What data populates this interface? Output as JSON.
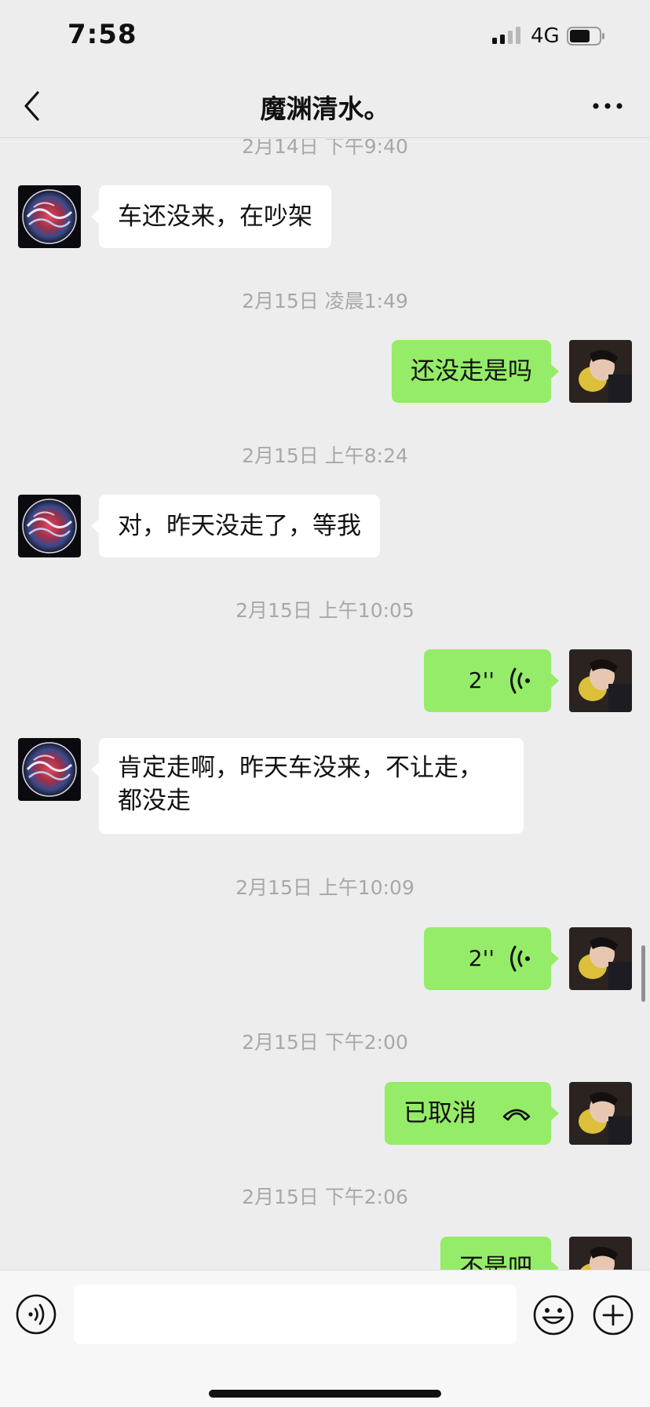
{
  "status_bar": {
    "time": "7:58",
    "network": "4G",
    "icons": [
      "signal-icon",
      "battery-icon"
    ]
  },
  "header": {
    "title": "魔渊清水。",
    "icons": [
      "back-icon",
      "more-icon"
    ]
  },
  "messages": [
    {
      "kind": "timestamp",
      "text": "2月14日 下午9:40"
    },
    {
      "kind": "text",
      "side": "left",
      "text": "车还没来，在吵架"
    },
    {
      "kind": "timestamp",
      "text": "2月15日 凌晨1:49"
    },
    {
      "kind": "text",
      "side": "right",
      "text": "还没走是吗"
    },
    {
      "kind": "timestamp",
      "text": "2月15日 上午8:24"
    },
    {
      "kind": "text",
      "side": "left",
      "text": "对，昨天没走了，等我"
    },
    {
      "kind": "timestamp",
      "text": "2月15日 上午10:05"
    },
    {
      "kind": "voice",
      "side": "right",
      "duration": "2''"
    },
    {
      "kind": "text",
      "side": "left",
      "lines": [
        "肯定走啊，昨天车没来，不让走，",
        "都没走"
      ]
    },
    {
      "kind": "timestamp",
      "text": "2月15日 上午10:09"
    },
    {
      "kind": "voice",
      "side": "right",
      "duration": "2''"
    },
    {
      "kind": "timestamp",
      "text": "2月15日 下午2:00"
    },
    {
      "kind": "call",
      "side": "right",
      "text": "已取消"
    },
    {
      "kind": "timestamp",
      "text": "2月15日 下午2:06"
    },
    {
      "kind": "text",
      "side": "right",
      "text": "不是吧"
    }
  ],
  "input_bar": {
    "placeholder": "",
    "icons": [
      "voice-input-icon",
      "emoji-icon",
      "plus-icon"
    ]
  },
  "colors": {
    "background": "#ededed",
    "sent_bubble": "#95ec69",
    "received_bubble": "#ffffff",
    "timestamp": "#a8a8a8"
  }
}
